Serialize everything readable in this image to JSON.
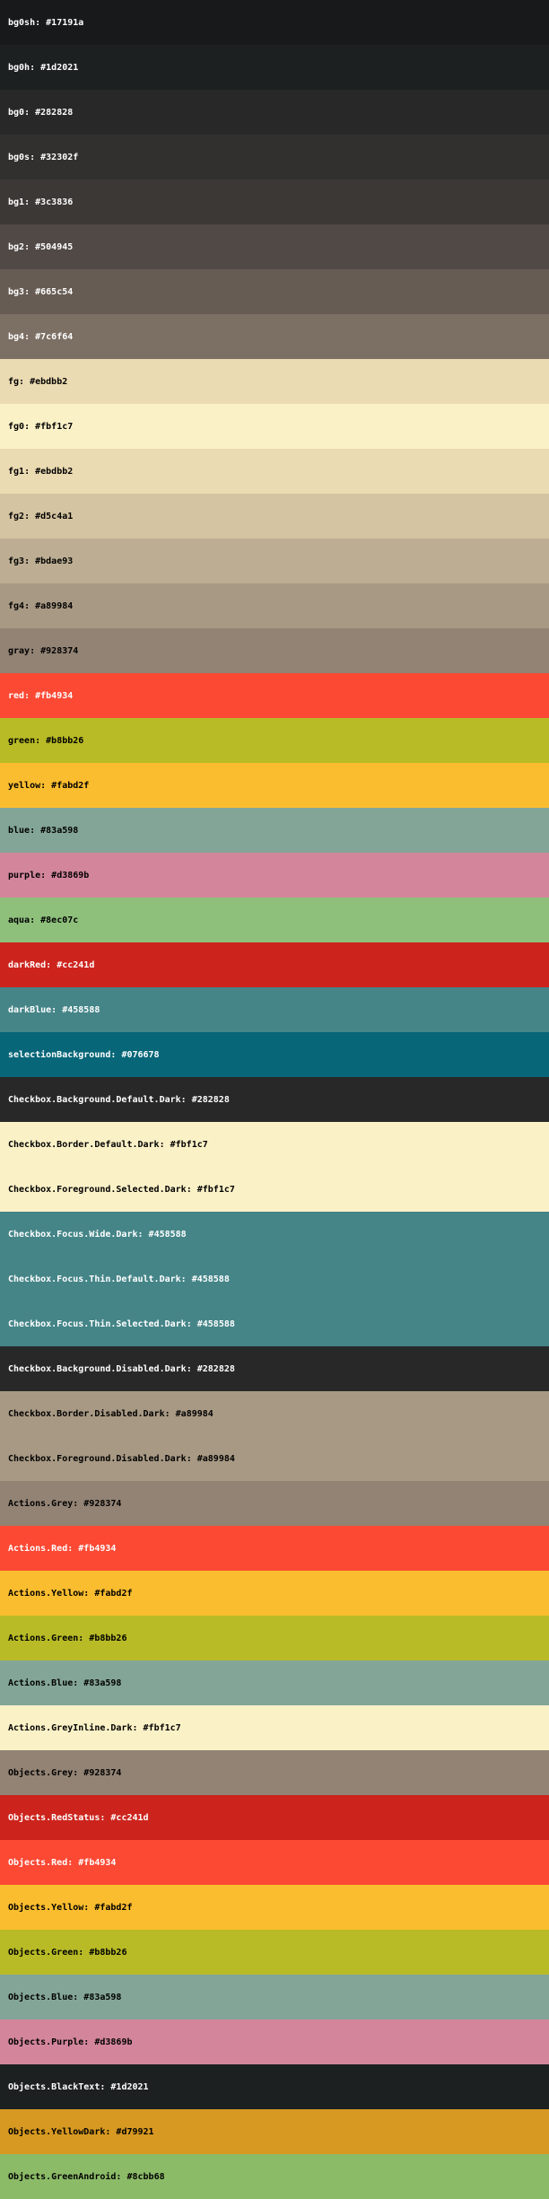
{
  "colors": [
    {
      "name": "bg0sh",
      "hex": "#17191a",
      "text_color": "#ffffff"
    },
    {
      "name": "bg0h",
      "hex": "#1d2021",
      "text_color": "#ffffff"
    },
    {
      "name": "bg0",
      "hex": "#282828",
      "text_color": "#ffffff"
    },
    {
      "name": "bg0s",
      "hex": "#32302f",
      "text_color": "#ffffff"
    },
    {
      "name": "bg1",
      "hex": "#3c3836",
      "text_color": "#ffffff"
    },
    {
      "name": "bg2",
      "hex": "#504945",
      "text_color": "#ffffff"
    },
    {
      "name": "bg3",
      "hex": "#665c54",
      "text_color": "#ffffff"
    },
    {
      "name": "bg4",
      "hex": "#7c6f64",
      "text_color": "#ffffff"
    },
    {
      "name": "fg",
      "hex": "#ebdbb2",
      "text_color": "#000000"
    },
    {
      "name": "fg0",
      "hex": "#fbf1c7",
      "text_color": "#000000"
    },
    {
      "name": "fg1",
      "hex": "#ebdbb2",
      "text_color": "#000000"
    },
    {
      "name": "fg2",
      "hex": "#d5c4a1",
      "text_color": "#000000"
    },
    {
      "name": "fg3",
      "hex": "#bdae93",
      "text_color": "#000000"
    },
    {
      "name": "fg4",
      "hex": "#a89984",
      "text_color": "#000000"
    },
    {
      "name": "gray",
      "hex": "#928374",
      "text_color": "#000000"
    },
    {
      "name": "red",
      "hex": "#fb4934",
      "text_color": "#ffffff"
    },
    {
      "name": "green",
      "hex": "#b8bb26",
      "text_color": "#000000"
    },
    {
      "name": "yellow",
      "hex": "#fabd2f",
      "text_color": "#000000"
    },
    {
      "name": "blue",
      "hex": "#83a598",
      "text_color": "#000000"
    },
    {
      "name": "purple",
      "hex": "#d3869b",
      "text_color": "#000000"
    },
    {
      "name": "aqua",
      "hex": "#8ec07c",
      "text_color": "#000000"
    },
    {
      "name": "darkRed",
      "hex": "#cc241d",
      "text_color": "#ffffff"
    },
    {
      "name": "darkBlue",
      "hex": "#458588",
      "text_color": "#ffffff"
    },
    {
      "name": "selectionBackground",
      "hex": "#076678",
      "text_color": "#ffffff"
    },
    {
      "name": "Checkbox.Background.Default.Dark",
      "hex": "#282828",
      "text_color": "#ffffff"
    },
    {
      "name": "Checkbox.Border.Default.Dark",
      "hex": "#fbf1c7",
      "text_color": "#000000"
    },
    {
      "name": "Checkbox.Foreground.Selected.Dark",
      "hex": "#fbf1c7",
      "text_color": "#000000"
    },
    {
      "name": "Checkbox.Focus.Wide.Dark",
      "hex": "#458588",
      "text_color": "#ffffff"
    },
    {
      "name": "Checkbox.Focus.Thin.Default.Dark",
      "hex": "#458588",
      "text_color": "#ffffff"
    },
    {
      "name": "Checkbox.Focus.Thin.Selected.Dark",
      "hex": "#458588",
      "text_color": "#ffffff"
    },
    {
      "name": "Checkbox.Background.Disabled.Dark",
      "hex": "#282828",
      "text_color": "#ffffff"
    },
    {
      "name": "Checkbox.Border.Disabled.Dark",
      "hex": "#a89984",
      "text_color": "#000000"
    },
    {
      "name": "Checkbox.Foreground.Disabled.Dark",
      "hex": "#a89984",
      "text_color": "#000000"
    },
    {
      "name": "Actions.Grey",
      "hex": "#928374",
      "text_color": "#000000"
    },
    {
      "name": "Actions.Red",
      "hex": "#fb4934",
      "text_color": "#ffffff"
    },
    {
      "name": "Actions.Yellow",
      "hex": "#fabd2f",
      "text_color": "#000000"
    },
    {
      "name": "Actions.Green",
      "hex": "#b8bb26",
      "text_color": "#000000"
    },
    {
      "name": "Actions.Blue",
      "hex": "#83a598",
      "text_color": "#000000"
    },
    {
      "name": "Actions.GreyInline.Dark",
      "hex": "#fbf1c7",
      "text_color": "#000000"
    },
    {
      "name": "Objects.Grey",
      "hex": "#928374",
      "text_color": "#000000"
    },
    {
      "name": "Objects.RedStatus",
      "hex": "#cc241d",
      "text_color": "#ffffff"
    },
    {
      "name": "Objects.Red",
      "hex": "#fb4934",
      "text_color": "#ffffff"
    },
    {
      "name": "Objects.Yellow",
      "hex": "#fabd2f",
      "text_color": "#000000"
    },
    {
      "name": "Objects.Green",
      "hex": "#b8bb26",
      "text_color": "#000000"
    },
    {
      "name": "Objects.Blue",
      "hex": "#83a598",
      "text_color": "#000000"
    },
    {
      "name": "Objects.Purple",
      "hex": "#d3869b",
      "text_color": "#000000"
    },
    {
      "name": "Objects.BlackText",
      "hex": "#1d2021",
      "text_color": "#ffffff"
    },
    {
      "name": "Objects.YellowDark",
      "hex": "#d79921",
      "text_color": "#000000"
    },
    {
      "name": "Objects.GreenAndroid",
      "hex": "#8cbb68",
      "text_color": "#000000"
    }
  ]
}
